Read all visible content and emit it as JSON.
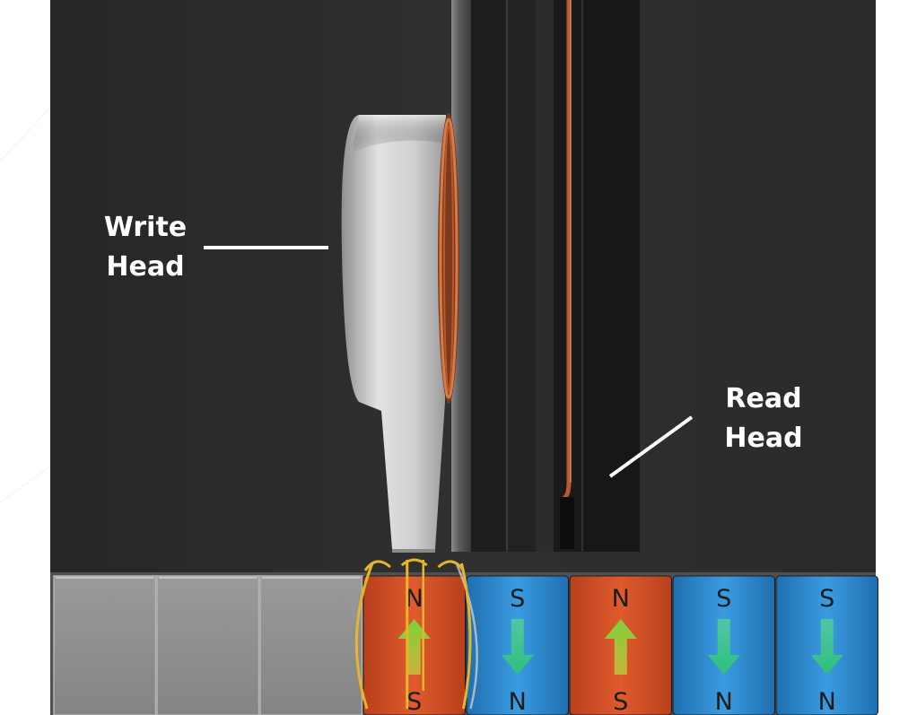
{
  "labels": {
    "write_head": [
      "Write",
      "Head"
    ],
    "read_head": [
      "Read",
      "Head"
    ]
  },
  "track": {
    "blank_cells": 3,
    "magnets": [
      {
        "top": "N",
        "bottom": "S",
        "arrow": "up",
        "color": "#d9532a",
        "writing": true
      },
      {
        "top": "S",
        "bottom": "N",
        "arrow": "down",
        "color": "#2f8fd6",
        "writing": false
      },
      {
        "top": "N",
        "bottom": "S",
        "arrow": "up",
        "color": "#d9532a",
        "writing": false
      },
      {
        "top": "S",
        "bottom": "N",
        "arrow": "down",
        "color": "#2f8fd6",
        "writing": false
      },
      {
        "top": "S",
        "bottom": "N",
        "arrow": "down",
        "color": "#2f8fd6",
        "writing": false
      }
    ]
  },
  "colors": {
    "background": "#2b2b2b",
    "white_margin": "#ffffff",
    "write_head_body": "#cfcfcf",
    "coil": "#c8693c",
    "arm_dark": "#1c1c1c",
    "arm_light": "#7a7a7a",
    "field_lines": "#e8b52a",
    "arrow_up": "#8fd13a",
    "arrow_down": "#3fbf8a",
    "pointer_line": "#ffffff"
  }
}
